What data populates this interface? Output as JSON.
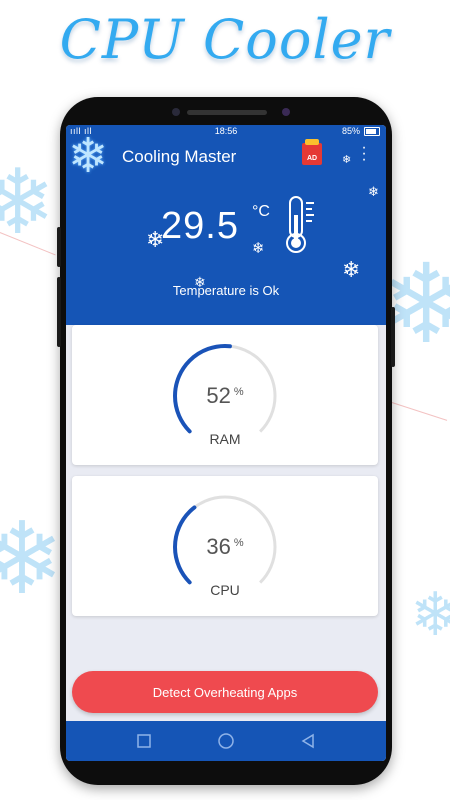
{
  "promo": {
    "title": "CPU Cooler"
  },
  "status_bar": {
    "signal": "ııll ıll",
    "time": "18:56",
    "battery": "85%"
  },
  "app": {
    "title": "Cooling Master",
    "ad_badge": "AD"
  },
  "temperature": {
    "value": "29.5",
    "unit": "°C",
    "status": "Temperature is Ok"
  },
  "gauges": [
    {
      "label": "RAM",
      "value": "52",
      "unit": "%",
      "percent": 52
    },
    {
      "label": "CPU",
      "value": "36",
      "unit": "%",
      "percent": 36
    }
  ],
  "action": {
    "detect_label": "Detect Overheating Apps"
  },
  "colors": {
    "primary": "#1555b6",
    "gauge_fill": "#1a53b8",
    "gauge_track": "#e0e0e0",
    "button": "#ef4a4f",
    "title": "#33aaf0"
  },
  "icons": {
    "logo": "snowflake-icon",
    "thermometer": "thermometer-icon",
    "ad": "gift-ad-icon",
    "menu": "more-vert-icon"
  }
}
